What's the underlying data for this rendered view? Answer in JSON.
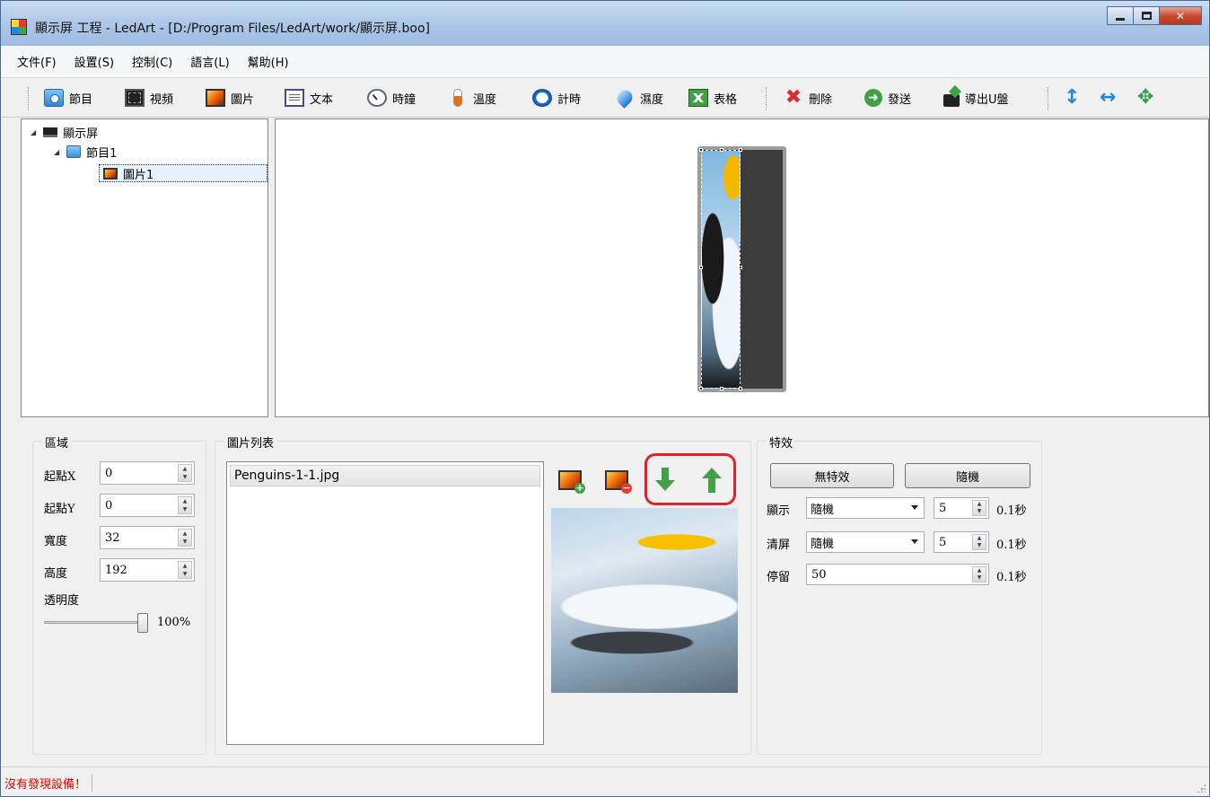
{
  "window": {
    "title": "顯示屏 工程 - LedArt - [D:/Program Files/LedArt/work/顯示屏.boo]"
  },
  "menu": [
    "文件(F)",
    "設置(S)",
    "控制(C)",
    "語言(L)",
    "幫助(H)"
  ],
  "toolbar": {
    "program": "節目",
    "video": "視頻",
    "picture": "圖片",
    "text": "文本",
    "clock": "時鐘",
    "temperature": "溫度",
    "timer": "計時",
    "humidity": "濕度",
    "table": "表格",
    "delete": "刪除",
    "send": "發送",
    "export_usb": "導出U盤"
  },
  "tree": {
    "root": "顯示屏",
    "program": "節目1",
    "picture": "圖片1"
  },
  "region": {
    "title": "區域",
    "start_x_label": "起點X",
    "start_x": "0",
    "start_y_label": "起點Y",
    "start_y": "0",
    "width_label": "寬度",
    "width": "32",
    "height_label": "高度",
    "height": "192",
    "opacity_label": "透明度",
    "opacity": "100%",
    "opacity_value": 1.0
  },
  "picture_list": {
    "title": "圖片列表",
    "items": [
      "Penguins-1-1.jpg"
    ]
  },
  "effects": {
    "title": "特效",
    "no_effect": "無特效",
    "random": "隨機",
    "display_label": "顯示",
    "display_mode": "隨機",
    "display_speed": "5",
    "clear_label": "清屏",
    "clear_mode": "隨機",
    "clear_speed": "5",
    "stay_label": "停留",
    "stay_value": "50",
    "unit": "0.1秒"
  },
  "status": {
    "message": "沒有發現設備！"
  }
}
